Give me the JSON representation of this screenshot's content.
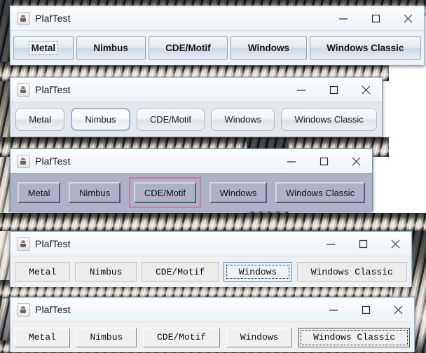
{
  "desktop": {
    "wallpaper_name": "photo-wallpaper",
    "background_color": "#ffffff"
  },
  "window_controls": {
    "minimize_label": "Minimize",
    "maximize_label": "Maximize",
    "close_label": "Close"
  },
  "icons": {
    "app_icon": "java-coffee-cup-icon",
    "minimize": "minimize-icon",
    "maximize": "maximize-icon",
    "close": "close-icon"
  },
  "windows": [
    {
      "id": "metal",
      "title": "PlafTest",
      "laf": "Metal",
      "panel_bg": "#eef2f7",
      "buttons": [
        {
          "label": "Metal",
          "selected": true
        },
        {
          "label": "Nimbus",
          "selected": false
        },
        {
          "label": "CDE/Motif",
          "selected": false
        },
        {
          "label": "Windows",
          "selected": false
        },
        {
          "label": "Windows Classic",
          "selected": false
        }
      ]
    },
    {
      "id": "nimbus",
      "title": "PlafTest",
      "laf": "Nimbus",
      "panel_bg": "#e4e7ec",
      "buttons": [
        {
          "label": "Metal",
          "selected": false
        },
        {
          "label": "Nimbus",
          "selected": true
        },
        {
          "label": "CDE/Motif",
          "selected": false
        },
        {
          "label": "Windows",
          "selected": false
        },
        {
          "label": "Windows Classic",
          "selected": false
        }
      ]
    },
    {
      "id": "motif",
      "title": "PlafTest",
      "laf": "CDE/Motif",
      "panel_bg": "#aeb2c8",
      "focus_color": "#c87ba0",
      "buttons": [
        {
          "label": "Metal",
          "selected": false
        },
        {
          "label": "Nimbus",
          "selected": false
        },
        {
          "label": "CDE/Motif",
          "selected": true
        },
        {
          "label": "Windows",
          "selected": false
        },
        {
          "label": "Windows Classic",
          "selected": false
        }
      ]
    },
    {
      "id": "windows",
      "title": "PlafTest",
      "laf": "Windows",
      "panel_bg": "#f0f0f0",
      "focus_color": "#3b8fd8",
      "buttons": [
        {
          "label": "Metal",
          "selected": false
        },
        {
          "label": "Nimbus",
          "selected": false
        },
        {
          "label": "CDE/Motif",
          "selected": false
        },
        {
          "label": "Windows",
          "selected": true
        },
        {
          "label": "Windows Classic",
          "selected": false
        }
      ]
    },
    {
      "id": "classic",
      "title": "PlafTest",
      "laf": "Windows Classic",
      "panel_bg": "#f0f0f0",
      "buttons": [
        {
          "label": "Metal",
          "selected": false
        },
        {
          "label": "Nimbus",
          "selected": false
        },
        {
          "label": "CDE/Motif",
          "selected": false
        },
        {
          "label": "Windows",
          "selected": false
        },
        {
          "label": "Windows Classic",
          "selected": true
        }
      ]
    }
  ]
}
